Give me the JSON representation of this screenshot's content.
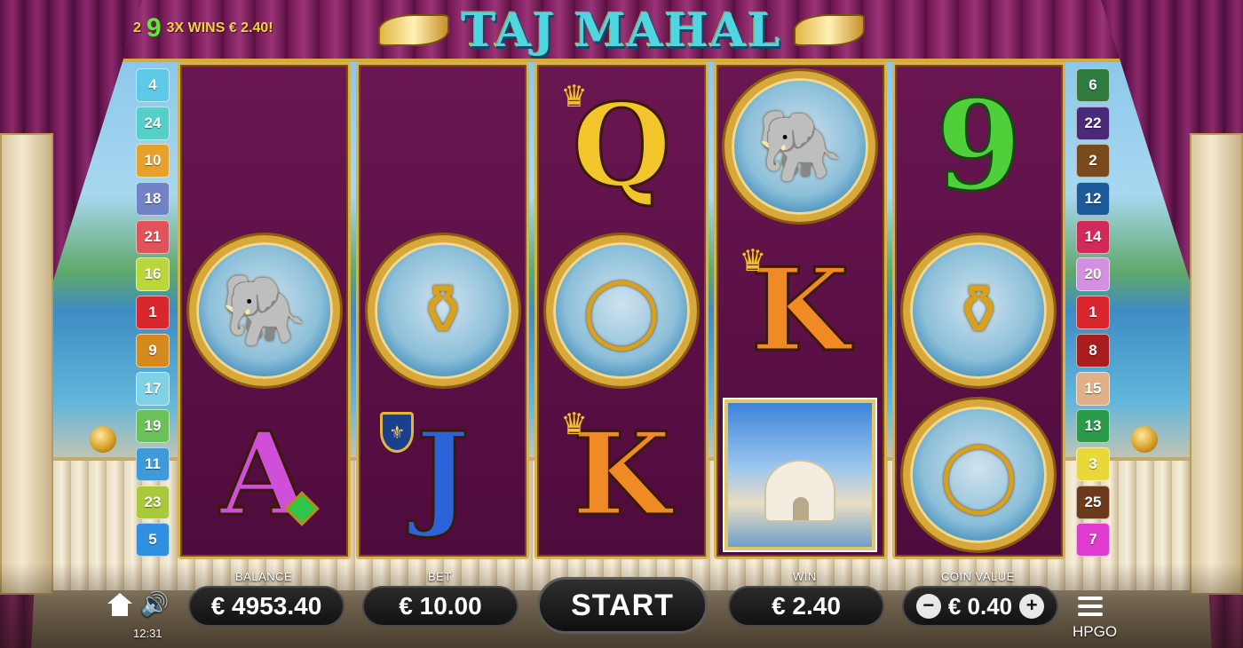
{
  "game": {
    "title": "TAJ MAHAL",
    "brand": "HPGO",
    "win_message": {
      "line_count": "2",
      "line_number": "9",
      "text": "3X WINS € 2.40!"
    }
  },
  "paylines": {
    "left": [
      {
        "num": "4",
        "color": "#5ec9e6"
      },
      {
        "num": "24",
        "color": "#55cfc8"
      },
      {
        "num": "10",
        "color": "#e6a12a"
      },
      {
        "num": "18",
        "color": "#7183c6"
      },
      {
        "num": "21",
        "color": "#e0535b"
      },
      {
        "num": "16",
        "color": "#b9d63a"
      },
      {
        "num": "1",
        "color": "#d8262c"
      },
      {
        "num": "9",
        "color": "#d48a1f"
      },
      {
        "num": "17",
        "color": "#7fd1e6"
      },
      {
        "num": "19",
        "color": "#6cc05a"
      },
      {
        "num": "11",
        "color": "#3e9ad8"
      },
      {
        "num": "23",
        "color": "#a9c83a"
      },
      {
        "num": "5",
        "color": "#2f8fe0"
      }
    ],
    "right": [
      {
        "num": "6",
        "color": "#2f7a3e"
      },
      {
        "num": "22",
        "color": "#4a2a78"
      },
      {
        "num": "2",
        "color": "#7a4a1c"
      },
      {
        "num": "12",
        "color": "#1c5a9c"
      },
      {
        "num": "14",
        "color": "#d22a58"
      },
      {
        "num": "20",
        "color": "#d58fe0"
      },
      {
        "num": "1",
        "color": "#d8262c"
      },
      {
        "num": "8",
        "color": "#a81e1e"
      },
      {
        "num": "15",
        "color": "#e0b088"
      },
      {
        "num": "13",
        "color": "#2a9a48"
      },
      {
        "num": "3",
        "color": "#e8d83a"
      },
      {
        "num": "25",
        "color": "#6a3a1a"
      },
      {
        "num": "7",
        "color": "#e03ad0"
      }
    ]
  },
  "reels": [
    {
      "symbols": [
        "empty",
        "elephant",
        "A"
      ]
    },
    {
      "symbols": [
        "empty",
        "golden-jug",
        "J"
      ]
    },
    {
      "symbols": [
        "Q",
        "gold-ring",
        "K"
      ]
    },
    {
      "symbols": [
        "elephant",
        "K",
        "taj-mahal"
      ]
    },
    {
      "symbols": [
        "9",
        "golden-jug",
        "gold-ring"
      ]
    }
  ],
  "symbol_letters": {
    "A": "A",
    "J": "J",
    "Q": "Q",
    "K": "K",
    "nine": "9"
  },
  "controls": {
    "balance_label": "BALANCE",
    "balance_value": "€ 4953.40",
    "bet_label": "BET",
    "bet_value": "€ 10.00",
    "start_label": "START",
    "win_label": "WIN",
    "win_value": "€ 2.40",
    "coin_label": "COIN VALUE",
    "coin_value": "€ 0.40",
    "minus_symbol": "−",
    "plus_symbol": "+"
  },
  "status": {
    "clock": "12:31"
  },
  "icons": {
    "home": "home-icon",
    "sound": "speaker-icon",
    "menu": "hamburger-menu-icon"
  },
  "colors": {
    "reel_bg": "#5a0f45",
    "reel_border": "#d9b24e",
    "title_color": "#4fd6e0",
    "win_text": "#f5d23a",
    "line_number_color": "#6be23a"
  }
}
